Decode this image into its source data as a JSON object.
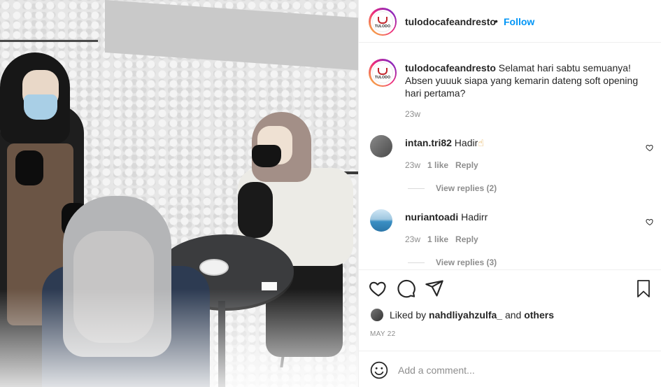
{
  "post": {
    "account": {
      "username": "tulodocafeandresto",
      "separator": "•",
      "follow_label": "Follow",
      "more_label": "",
      "logo_text": "TULODO"
    },
    "caption": {
      "username": "tulodocafeandresto",
      "text": "Selamat hari sabtu semuanya! Absen yuuuk siapa yang kemarin dateng soft opening hari pertama?",
      "time": "23w"
    },
    "comments": [
      {
        "username": "intan.tri82",
        "text": "Hadir",
        "emoji": "☝",
        "time": "23w",
        "likes": "1 like",
        "reply_label": "Reply",
        "view_replies": "View replies (2)"
      },
      {
        "username": "nuriantoadi",
        "text": "Hadirr",
        "time": "23w",
        "likes": "1 like",
        "reply_label": "Reply",
        "view_replies": "View replies (3)"
      }
    ],
    "liked_by": {
      "prefix": "Liked by",
      "user": "nahdliyahzulfa_",
      "and": "and",
      "others": "others"
    },
    "date": "MAY 22",
    "add_comment": {
      "placeholder": "Add a comment..."
    },
    "icons": {
      "like": "heart-icon",
      "comment": "comment-icon",
      "share": "share-icon",
      "save": "bookmark-icon",
      "emoji": "emoji-icon"
    },
    "colors": {
      "follow": "#0095f6",
      "meta": "#8e8e8e",
      "text": "#262626"
    }
  }
}
